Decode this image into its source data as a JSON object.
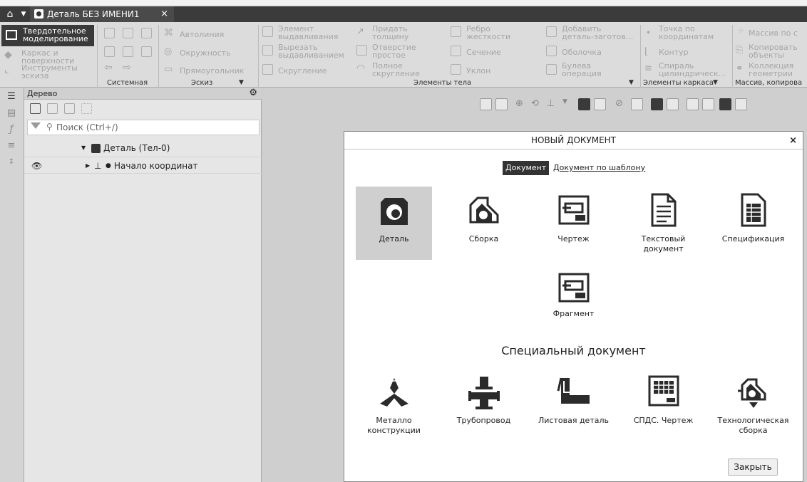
{
  "tabbar": {
    "home_icon": "home-icon",
    "doc_tab_label": "Деталь БЕЗ ИМЕНИ1",
    "close_glyph": "×"
  },
  "ribbon": {
    "modes": [
      {
        "label_l1": "Твердотельное",
        "label_l2": "моделирование",
        "active": true
      },
      {
        "label_l1": "Каркас и",
        "label_l2": "поверхности",
        "active": false
      },
      {
        "label_l1": "Инструменты",
        "label_l2": "эскиза",
        "active": false
      }
    ],
    "sketch_items": [
      "Автолиния",
      "Окружность",
      "Прямоугольник"
    ],
    "body_col1": [
      {
        "l1": "Элемент",
        "l2": "выдавливания"
      },
      {
        "l1": "Вырезать",
        "l2": "выдавливанием"
      },
      {
        "l1": "Скругление",
        "l2": ""
      }
    ],
    "body_col2": [
      {
        "l1": "Придать",
        "l2": "толщину"
      },
      {
        "l1": "Отверстие",
        "l2": "простое"
      },
      {
        "l1": "Полное",
        "l2": "скругление"
      }
    ],
    "body_col3": [
      {
        "l1": "Ребро",
        "l2": "жесткости"
      },
      {
        "l1": "Сечение",
        "l2": ""
      },
      {
        "l1": "Уклон",
        "l2": ""
      }
    ],
    "body_col4": [
      {
        "l1": "Добавить",
        "l2": "деталь-заготов..."
      },
      {
        "l1": "Оболочка",
        "l2": ""
      },
      {
        "l1": "Булева",
        "l2": "операция"
      }
    ],
    "frame_col": [
      {
        "l1": "Точка по",
        "l2": "координатам"
      },
      {
        "l1": "Контур",
        "l2": ""
      },
      {
        "l1": "Спираль",
        "l2": "цилиндрическ..."
      }
    ],
    "array_col": [
      {
        "l1": "Массив по с",
        "l2": ""
      },
      {
        "l1": "Копировать",
        "l2": "объекты"
      },
      {
        "l1": "Коллекция",
        "l2": "геометрии"
      }
    ],
    "groups": {
      "system": "Системная",
      "sketch": "Эскиз",
      "body": "Элементы тела",
      "frame": "Элементы каркаса",
      "array": "Массив, копирова"
    }
  },
  "tree": {
    "title": "Дерево",
    "search_placeholder": "Поиск (Ctrl+/)",
    "rows": [
      {
        "label": "Деталь (Тел-0)"
      },
      {
        "label": "Начало координат"
      }
    ]
  },
  "dialog": {
    "title": "НОВЫЙ ДОКУМЕНТ",
    "close_glyph": "×",
    "tab_active": "Документ",
    "tab_template": "Документ по шаблону",
    "docs": [
      {
        "label_l1": "Деталь",
        "label_l2": "",
        "icon": "part-icon",
        "selected": true
      },
      {
        "label_l1": "Сборка",
        "label_l2": "",
        "icon": "assembly-icon",
        "selected": false
      },
      {
        "label_l1": "Чертеж",
        "label_l2": "",
        "icon": "drawing-icon",
        "selected": false
      },
      {
        "label_l1": "Текстовый",
        "label_l2": "документ",
        "icon": "text-document-icon",
        "selected": false
      },
      {
        "label_l1": "Спецификация",
        "label_l2": "",
        "icon": "specification-icon",
        "selected": false
      },
      {
        "label_l1": "Фрагмент",
        "label_l2": "",
        "icon": "fragment-icon",
        "selected": false
      }
    ],
    "special_title": "Специальный документ",
    "special_docs": [
      {
        "label_l1": "Металло",
        "label_l2": "конструкции",
        "icon": "metal-structures-icon"
      },
      {
        "label_l1": "Трубопровод",
        "label_l2": "",
        "icon": "pipeline-icon"
      },
      {
        "label_l1": "Листовая деталь",
        "label_l2": "",
        "icon": "sheet-metal-icon"
      },
      {
        "label_l1": "СПДС. Чертеж",
        "label_l2": "",
        "icon": "spds-drawing-icon"
      },
      {
        "label_l1": "Технологическая",
        "label_l2": "сборка",
        "icon": "technological-assembly-icon"
      }
    ],
    "close_button": "Закрыть"
  },
  "colors": {
    "dark_bar": "#3b3b3b",
    "ribbon_bg": "#dcdcdc",
    "workspace_bg": "#cfcfcf",
    "selected_tile": "#cfcfcf"
  }
}
